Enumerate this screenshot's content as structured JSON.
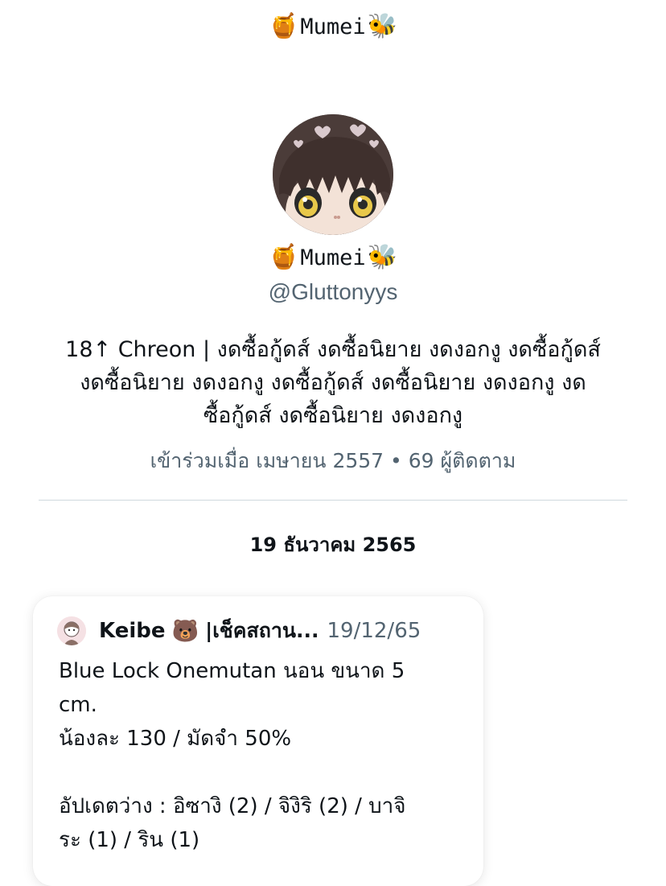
{
  "header": {
    "title": "Mumei",
    "title_prefix_icon": "honey-pot-icon",
    "title_suffix_icon": "honeybee-icon",
    "prefix_glyph": "🍯",
    "suffix_glyph": "🐝"
  },
  "profile": {
    "display_name": "Mumei",
    "prefix_glyph": "🍯",
    "suffix_glyph": "🐝",
    "handle": "@Gluttonyys",
    "bio_lines": [
      "18↑ Chreon | งดซื้อกู้ดส์ งดซื้อนิยาย งดงอกงู งดซื้อกู้ดส์",
      "งดซื้อนิยาย งดงอกงู งดซื้อกู้ดส์ งดซื้อนิยาย งดงอกงู งด",
      "ซื้อกู้ดส์ งดซื้อนิยาย งดงอกงู"
    ],
    "meta": "เข้าร่วมเมื่อ เมษายน 2557 • 69 ผู้ติดตาม"
  },
  "timeline": {
    "date_heading": "19 ธันวาคม 2565"
  },
  "tweet": {
    "author": "Keibe",
    "author_glyph": "🐻",
    "author_suffix": "|เช็คสถาน...",
    "date": "19/12/65",
    "body_lines": [
      "Blue Lock Onemutan นอน ขนาด 5",
      "cm.",
      "น้องละ 130 / มัดจำ 50%",
      "",
      "อัปเดตว่าง : อิซางิ (2) / จิงิริ (2) / บาจิ",
      "ระ (1) / ริน (1)"
    ]
  },
  "colors": {
    "text_primary": "#0f1419",
    "text_secondary": "#536471",
    "divider": "#cfd9de"
  }
}
